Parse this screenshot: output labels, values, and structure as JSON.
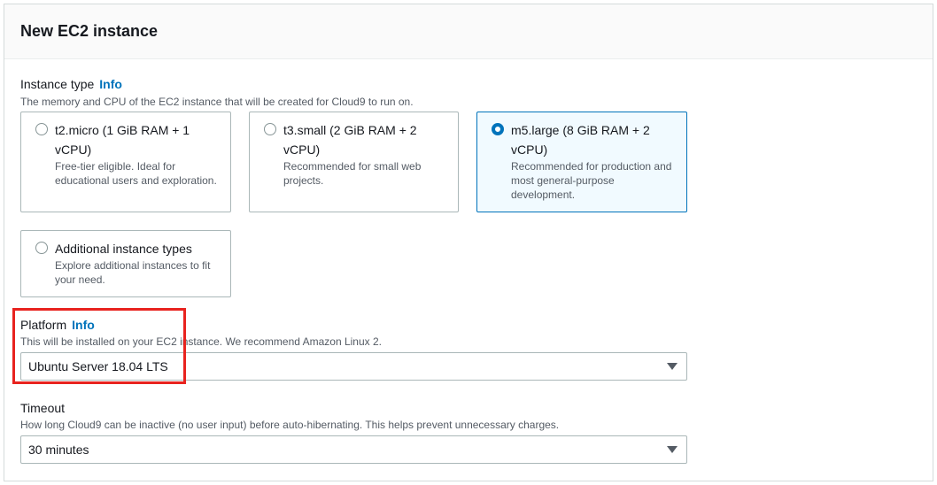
{
  "panel": {
    "title": "New EC2 instance"
  },
  "instance_type": {
    "label": "Instance type",
    "info": "Info",
    "description": "The memory and CPU of the EC2 instance that will be created for Cloud9 to run on.",
    "options": [
      {
        "title": "t2.micro (1 GiB RAM + 1 vCPU)",
        "description": "Free-tier eligible. Ideal for educational users and exploration.",
        "selected": false
      },
      {
        "title": "t3.small (2 GiB RAM + 2 vCPU)",
        "description": "Recommended for small web projects.",
        "selected": false
      },
      {
        "title": "m5.large (8 GiB RAM + 2 vCPU)",
        "description": "Recommended for production and most general-purpose development.",
        "selected": true
      },
      {
        "title": "Additional instance types",
        "description": "Explore additional instances to fit your need.",
        "selected": false
      }
    ]
  },
  "platform": {
    "label": "Platform",
    "info": "Info",
    "description": "This will be installed on your EC2 instance. We recommend Amazon Linux 2.",
    "value": "Ubuntu Server 18.04 LTS"
  },
  "timeout": {
    "label": "Timeout",
    "description": "How long Cloud9 can be inactive (no user input) before auto-hibernating. This helps prevent unnecessary charges.",
    "value": "30 minutes"
  },
  "colors": {
    "accent": "#0073bb",
    "highlight": "#e8231f"
  }
}
